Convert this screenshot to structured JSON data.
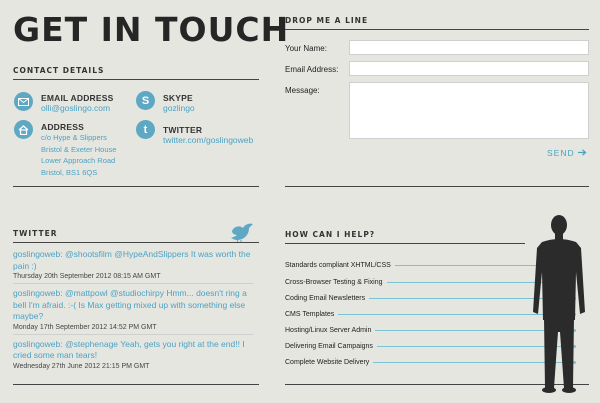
{
  "header": {
    "title": "GET IN TOUCH"
  },
  "contact": {
    "heading": "CONTACT DETAILS",
    "email": {
      "label": "EMAIL ADDRESS",
      "value": "olli@goslingo.com",
      "icon": "envelope-icon"
    },
    "skype": {
      "label": "SKYPE",
      "value": "gozlingo",
      "icon": "skype-icon"
    },
    "address": {
      "label": "ADDRESS",
      "lines": "c/o Hype & Slippers\nBristol & Exeter House\nLower Approach Road\nBristol, BS1 6QS",
      "icon": "house-icon"
    },
    "twitter": {
      "label": "TWITTER",
      "value": "twitter.com/goslingoweb",
      "icon": "twitter-bird-icon"
    }
  },
  "form": {
    "heading": "DROP ME A LINE",
    "name_label": "Your Name:",
    "name_value": "",
    "email_label": "Email Address:",
    "email_value": "",
    "message_label": "Message:",
    "message_value": "",
    "send_label": "SEND",
    "send_icon": "arrow-right-icon"
  },
  "twitter_feed": {
    "heading": "TWITTER",
    "icon": "bird-icon",
    "tweets": [
      {
        "text": "goslingoweb: @shootsfilm @HypeAndSlippers It was worth the pain :)",
        "date": "Thursday 20th September 2012 08:15 AM GMT"
      },
      {
        "text": "goslingoweb: @mattpowl @studiochirpy Hmm... doesn't ring a bell I'm afraid. :-( Is Max getting mixed up with something else maybe?",
        "date": "Monday 17th September 2012 14:52 PM GMT"
      },
      {
        "text": "goslingoweb: @stephenage Yeah, gets you right at the end!! I cried some man tears!",
        "date": "Wednesday 27th June 2012 21:15 PM GMT"
      }
    ]
  },
  "services": {
    "heading": "HOW CAN I HELP?",
    "items": [
      "Standards compliant XHTML/CSS",
      "Cross-Browser Testing & Fixing",
      "Coding Email Newsletters",
      "CMS Templates",
      "Hosting/Linux Server Admin",
      "Delivering Email Campaigns",
      "Complete Website Delivery"
    ]
  },
  "colors": {
    "accent": "#4ba3c3",
    "background": "#e6e6e1",
    "figure": "#2b2b2b"
  }
}
